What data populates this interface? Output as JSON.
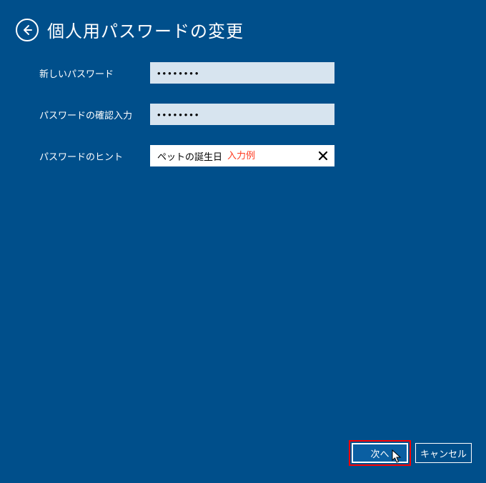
{
  "header": {
    "title": "個人用パスワードの変更"
  },
  "form": {
    "new_password": {
      "label": "新しいパスワード",
      "value": "••••••••"
    },
    "confirm_password": {
      "label": "パスワードの確認入力",
      "value": "••••••••"
    },
    "hint": {
      "label": "パスワードのヒント",
      "value": "ペットの誕生日",
      "example_tag": "入力例"
    }
  },
  "footer": {
    "next": "次へ",
    "cancel": "キャンセル"
  }
}
